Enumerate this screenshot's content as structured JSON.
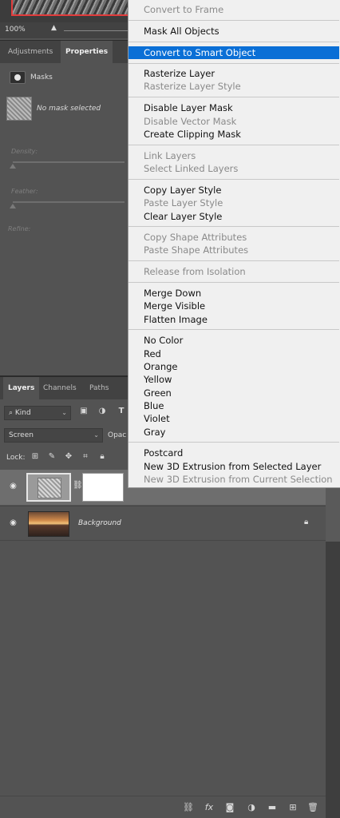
{
  "canvas": {
    "zoom": "100%"
  },
  "properties_panel": {
    "tabs": [
      "Adjustments",
      "Properties"
    ],
    "active_tab": "Properties",
    "section_title": "Masks",
    "no_selection": "No mask selected",
    "density_label": "Density:",
    "feather_label": "Feather:",
    "refine_label": "Refine:"
  },
  "layers_panel": {
    "tabs": [
      "Layers",
      "Channels",
      "Paths"
    ],
    "active_tab": "Layers",
    "filter_kind": "Kind",
    "blend_mode": "Screen",
    "opacity_label": "Opac",
    "lock_label": "Lock:",
    "layers": [
      {
        "name": "",
        "visible": true,
        "selected": true,
        "has_mask": true
      },
      {
        "name": "Background",
        "visible": true,
        "selected": false,
        "locked": true
      }
    ]
  },
  "context_menu": {
    "items": [
      {
        "label": "Convert to Frame",
        "disabled": true
      },
      {
        "label": "Mask All Objects",
        "disabled": false
      },
      {
        "label": "Convert to Smart Object",
        "disabled": false,
        "highlighted": true
      },
      {
        "label": "Rasterize Layer",
        "disabled": false
      },
      {
        "label": "Rasterize Layer Style",
        "disabled": true
      },
      {
        "label": "Disable Layer Mask",
        "disabled": false
      },
      {
        "label": "Disable Vector Mask",
        "disabled": true
      },
      {
        "label": "Create Clipping Mask",
        "disabled": false
      },
      {
        "label": "Link Layers",
        "disabled": true
      },
      {
        "label": "Select Linked Layers",
        "disabled": true
      },
      {
        "label": "Copy Layer Style",
        "disabled": false
      },
      {
        "label": "Paste Layer Style",
        "disabled": true
      },
      {
        "label": "Clear Layer Style",
        "disabled": false
      },
      {
        "label": "Copy Shape Attributes",
        "disabled": true
      },
      {
        "label": "Paste Shape Attributes",
        "disabled": true
      },
      {
        "label": "Release from Isolation",
        "disabled": true
      },
      {
        "label": "Merge Down",
        "disabled": false
      },
      {
        "label": "Merge Visible",
        "disabled": false
      },
      {
        "label": "Flatten Image",
        "disabled": false
      },
      {
        "label": "No Color",
        "disabled": false
      },
      {
        "label": "Red",
        "disabled": false
      },
      {
        "label": "Orange",
        "disabled": false
      },
      {
        "label": "Yellow",
        "disabled": false
      },
      {
        "label": "Green",
        "disabled": false
      },
      {
        "label": "Blue",
        "disabled": false
      },
      {
        "label": "Violet",
        "disabled": false
      },
      {
        "label": "Gray",
        "disabled": false
      },
      {
        "label": "Postcard",
        "disabled": false
      },
      {
        "label": "New 3D Extrusion from Selected Layer",
        "disabled": false
      },
      {
        "label": "New 3D Extrusion from Current Selection",
        "disabled": true
      }
    ]
  },
  "colors": {
    "highlight": "#0a6fd6",
    "panel_bg": "#535353",
    "menu_bg": "#f0f0f0"
  },
  "icons": {
    "filter": [
      "image-filter-icon",
      "adjustment-filter-icon",
      "type-filter-icon"
    ],
    "lock": [
      "lock-transparent-icon",
      "lock-paint-icon",
      "lock-position-icon",
      "lock-artboard-icon",
      "lock-all-icon"
    ],
    "footer": [
      "link-layers-icon",
      "fx-icon",
      "add-mask-icon",
      "adjustment-layer-icon",
      "new-group-icon",
      "new-layer-icon",
      "delete-layer-icon"
    ]
  }
}
